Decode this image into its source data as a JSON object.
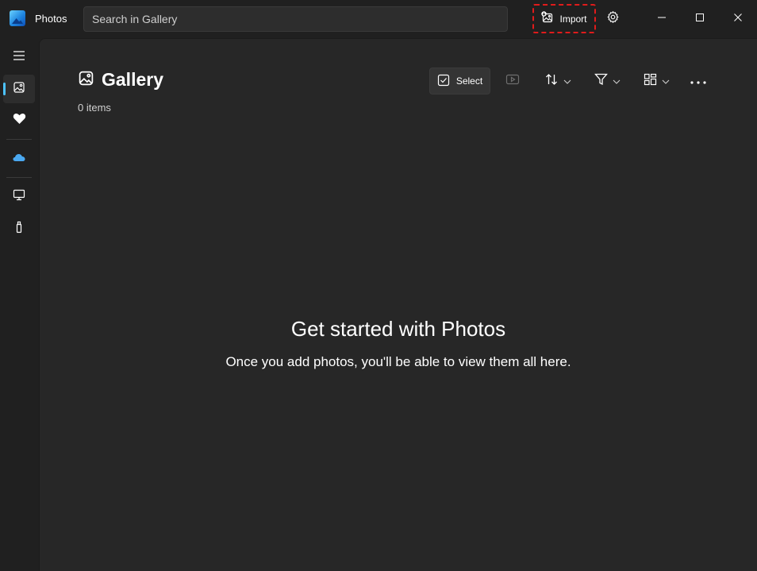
{
  "app": {
    "name": "Photos"
  },
  "search": {
    "placeholder": "Search in Gallery"
  },
  "toolbar": {
    "import_label": "Import"
  },
  "sidebar": {
    "items": [
      {
        "name": "menu",
        "icon": "hamburger-icon"
      },
      {
        "name": "gallery",
        "icon": "gallery-icon",
        "active": true
      },
      {
        "name": "favorites",
        "icon": "heart-icon"
      },
      {
        "name": "onedrive",
        "icon": "cloud-icon"
      },
      {
        "name": "this-pc",
        "icon": "monitor-icon"
      },
      {
        "name": "external-drive",
        "icon": "usb-drive-icon"
      }
    ]
  },
  "page": {
    "title": "Gallery",
    "item_count": "0 items",
    "select_label": "Select"
  },
  "empty_state": {
    "title": "Get started with Photos",
    "subtitle": "Once you add photos, you'll be able to view them all here."
  },
  "colors": {
    "accent": "#4cc2ff",
    "import_highlight": "#e01b1b",
    "onedrive": "#4aa8f0",
    "background": "#202020",
    "content_background": "#272727"
  }
}
